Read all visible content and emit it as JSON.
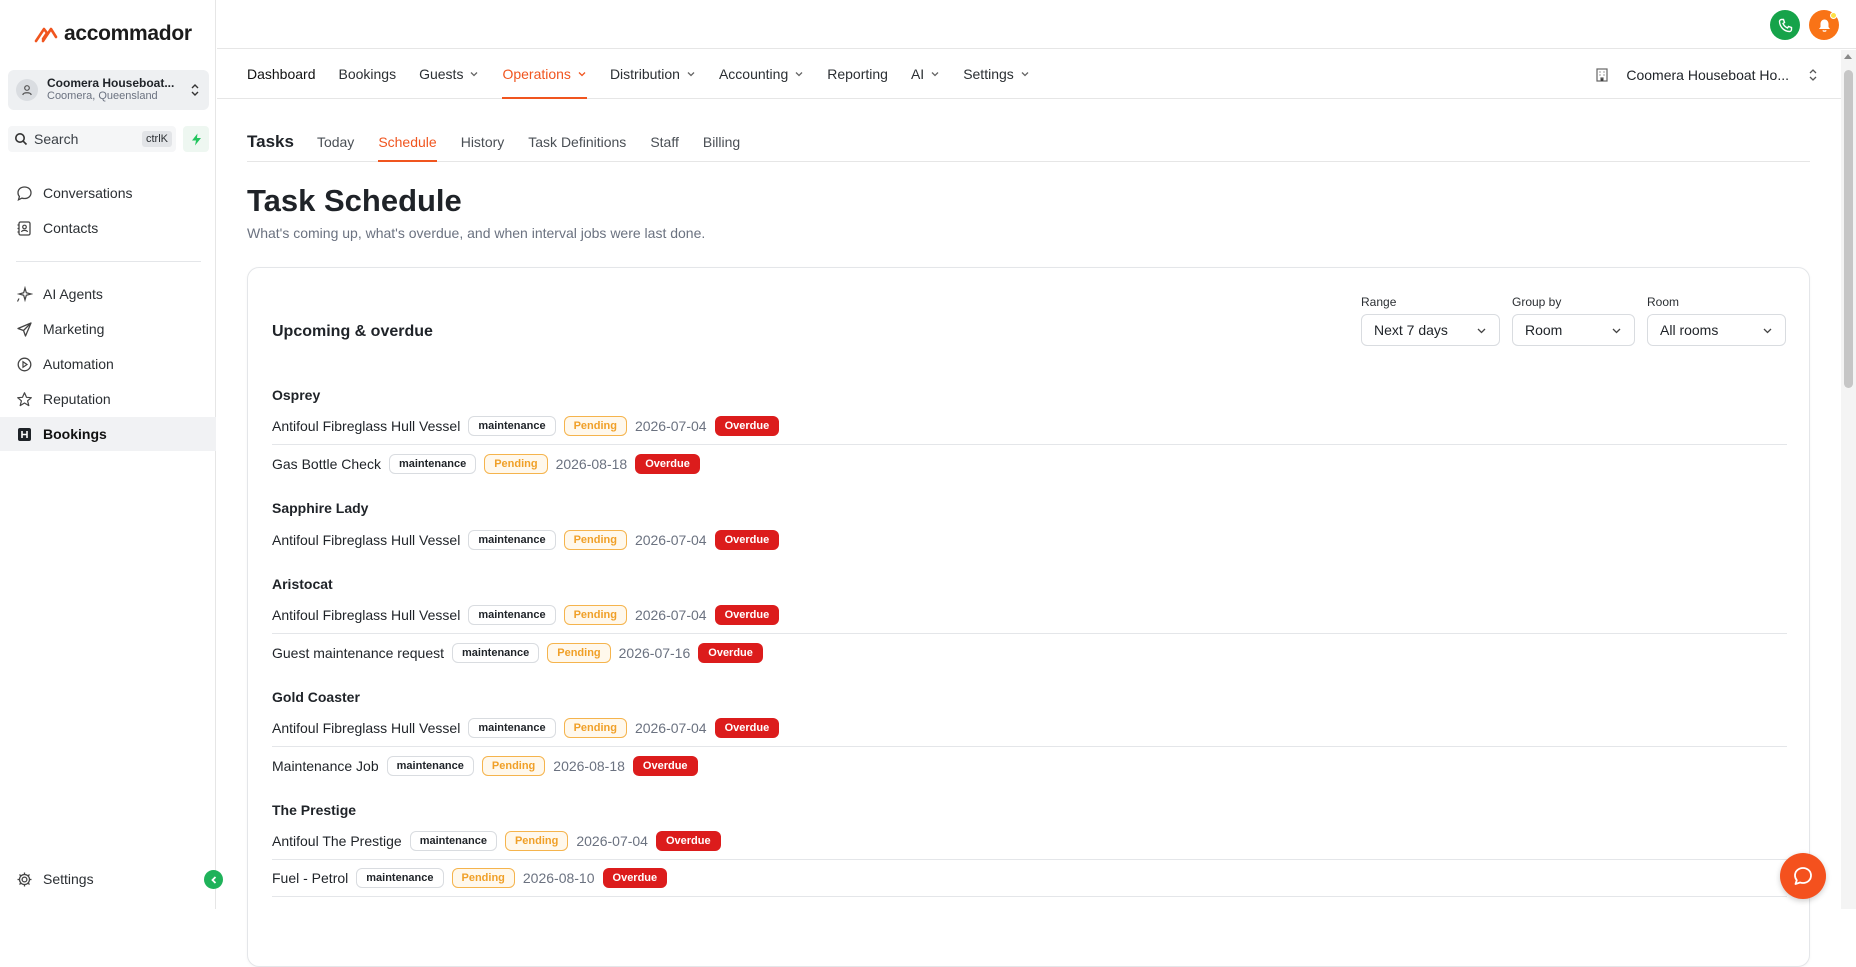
{
  "brand": {
    "name": "accommador",
    "accent": "#f0551f"
  },
  "property": {
    "name": "Coomera Houseboat...",
    "location": "Coomera, Queensland"
  },
  "search": {
    "label": "Search",
    "shortcut": "ctrlK"
  },
  "sidebar": {
    "items": [
      {
        "label": "Conversations",
        "icon": "chat-bubble-icon"
      },
      {
        "label": "Contacts",
        "icon": "address-book-icon"
      },
      {
        "label": "AI Agents",
        "icon": "sparkles-icon"
      },
      {
        "label": "Marketing",
        "icon": "send-icon"
      },
      {
        "label": "Automation",
        "icon": "play-circle-icon"
      },
      {
        "label": "Reputation",
        "icon": "star-icon"
      },
      {
        "label": "Bookings",
        "icon": "bookings-icon",
        "active": true
      }
    ],
    "settings_label": "Settings"
  },
  "mainnav": {
    "items": [
      {
        "label": "Dashboard"
      },
      {
        "label": "Bookings"
      },
      {
        "label": "Guests",
        "dropdown": true
      },
      {
        "label": "Operations",
        "dropdown": true,
        "active": true
      },
      {
        "label": "Distribution",
        "dropdown": true
      },
      {
        "label": "Accounting",
        "dropdown": true
      },
      {
        "label": "Reporting"
      },
      {
        "label": "AI",
        "dropdown": true
      },
      {
        "label": "Settings",
        "dropdown": true
      }
    ],
    "property_selector": "Coomera Houseboat Ho..."
  },
  "subtabs": {
    "title": "Tasks",
    "items": [
      "Today",
      "Schedule",
      "History",
      "Task Definitions",
      "Staff",
      "Billing"
    ],
    "active": "Schedule"
  },
  "page": {
    "title": "Task Schedule",
    "subtitle": "What's coming up, what's overdue, and when interval jobs were last done."
  },
  "card": {
    "title": "Upcoming & overdue",
    "filters": {
      "range": {
        "label": "Range",
        "value": "Next 7 days"
      },
      "group_by": {
        "label": "Group by",
        "value": "Room"
      },
      "room": {
        "label": "Room",
        "value": "All rooms"
      }
    },
    "groups": [
      {
        "name": "Osprey",
        "tasks": [
          {
            "name": "Antifoul Fibreglass Hull Vessel",
            "category": "maintenance",
            "status": "Pending",
            "date": "2026-07-04",
            "flag": "Overdue"
          },
          {
            "name": "Gas Bottle Check",
            "category": "maintenance",
            "status": "Pending",
            "date": "2026-08-18",
            "flag": "Overdue"
          }
        ]
      },
      {
        "name": "Sapphire Lady",
        "tasks": [
          {
            "name": "Antifoul Fibreglass Hull Vessel",
            "category": "maintenance",
            "status": "Pending",
            "date": "2026-07-04",
            "flag": "Overdue"
          }
        ]
      },
      {
        "name": "Aristocat",
        "tasks": [
          {
            "name": "Antifoul Fibreglass Hull Vessel",
            "category": "maintenance",
            "status": "Pending",
            "date": "2026-07-04",
            "flag": "Overdue"
          },
          {
            "name": "Guest maintenance request",
            "category": "maintenance",
            "status": "Pending",
            "date": "2026-07-16",
            "flag": "Overdue"
          }
        ]
      },
      {
        "name": "Gold Coaster",
        "tasks": [
          {
            "name": "Antifoul Fibreglass Hull Vessel",
            "category": "maintenance",
            "status": "Pending",
            "date": "2026-07-04",
            "flag": "Overdue"
          },
          {
            "name": "Maintenance Job",
            "category": "maintenance",
            "status": "Pending",
            "date": "2026-08-18",
            "flag": "Overdue"
          }
        ]
      },
      {
        "name": "The Prestige",
        "tasks": [
          {
            "name": "Antifoul The Prestige",
            "category": "maintenance",
            "status": "Pending",
            "date": "2026-07-04",
            "flag": "Overdue"
          },
          {
            "name": "Fuel - Petrol",
            "category": "maintenance",
            "status": "Pending",
            "date": "2026-08-10",
            "flag": "Overdue"
          }
        ]
      }
    ]
  }
}
